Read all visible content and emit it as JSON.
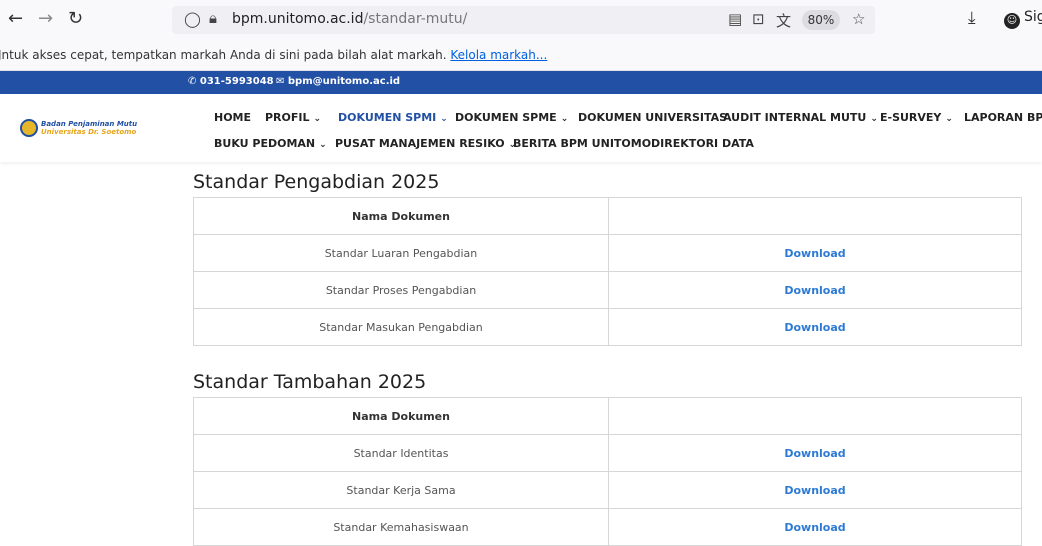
{
  "browser": {
    "url_host": "bpm.unitomo.ac.id",
    "url_path": "/standar-mutu/",
    "zoom": "80%",
    "sign_in": "Sig",
    "bookmarks_text": "Jntuk akses cepat, tempatkan markah Anda di sini pada bilah alat markah.",
    "bookmarks_link": "Kelola markah..."
  },
  "topbar": {
    "phone": "031-5993048",
    "email": "bpm@unitomo.ac.id"
  },
  "logo": {
    "line1": "Badan Penjaminan Mutu",
    "line2": "Universitas Dr. Soetomo"
  },
  "nav": {
    "row1": [
      "HOME",
      "PROFIL",
      "DOKUMEN SPMI",
      "DOKUMEN SPME",
      "DOKUMEN UNIVERSITAS",
      "AUDIT INTERNAL MUTU",
      "E-SURVEY",
      "LAPORAN BPM"
    ],
    "row2": [
      "BUKU PEDOMAN",
      "PUSAT MANAJEMEN RESIKO",
      "BERITA BPM UNITOMO",
      "DIREKTORI DATA"
    ],
    "active": "DOKUMEN SPMI",
    "accent": "#2150a4"
  },
  "sections": [
    {
      "title": "Standar Pengabdian 2025",
      "header_col1": "Nama Dokumen",
      "header_col2": "",
      "rows": [
        {
          "name": "Standar Luaran Pengabdian",
          "action": "Download"
        },
        {
          "name": "Standar Proses Pengabdian",
          "action": "Download"
        },
        {
          "name": "Standar Masukan Pengabdian",
          "action": "Download"
        }
      ]
    },
    {
      "title": "Standar Tambahan 2025",
      "header_col1": "Nama Dokumen",
      "header_col2": "",
      "rows": [
        {
          "name": "Standar Identitas",
          "action": "Download"
        },
        {
          "name": "Standar Kerja Sama",
          "action": "Download"
        },
        {
          "name": "Standar Kemahasiswaan",
          "action": "Download"
        }
      ]
    }
  ]
}
